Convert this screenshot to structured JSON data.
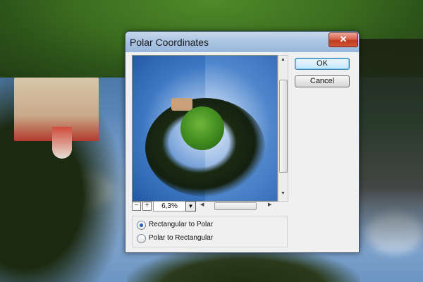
{
  "dialog": {
    "title": "Polar Coordinates",
    "close_symbol": "✕",
    "buttons": {
      "ok": "OK",
      "cancel": "Cancel"
    },
    "zoom": {
      "minus": "−",
      "plus": "+",
      "value": "6,3%",
      "dropdown": "▼"
    },
    "options": [
      {
        "label": "Rectangular to Polar",
        "selected": true
      },
      {
        "label": "Polar to Rectangular",
        "selected": false
      }
    ],
    "icons": {
      "close": "close-icon",
      "scroll_up": "▲",
      "scroll_down": "▼",
      "scroll_left": "◀",
      "scroll_right": "▶"
    }
  }
}
